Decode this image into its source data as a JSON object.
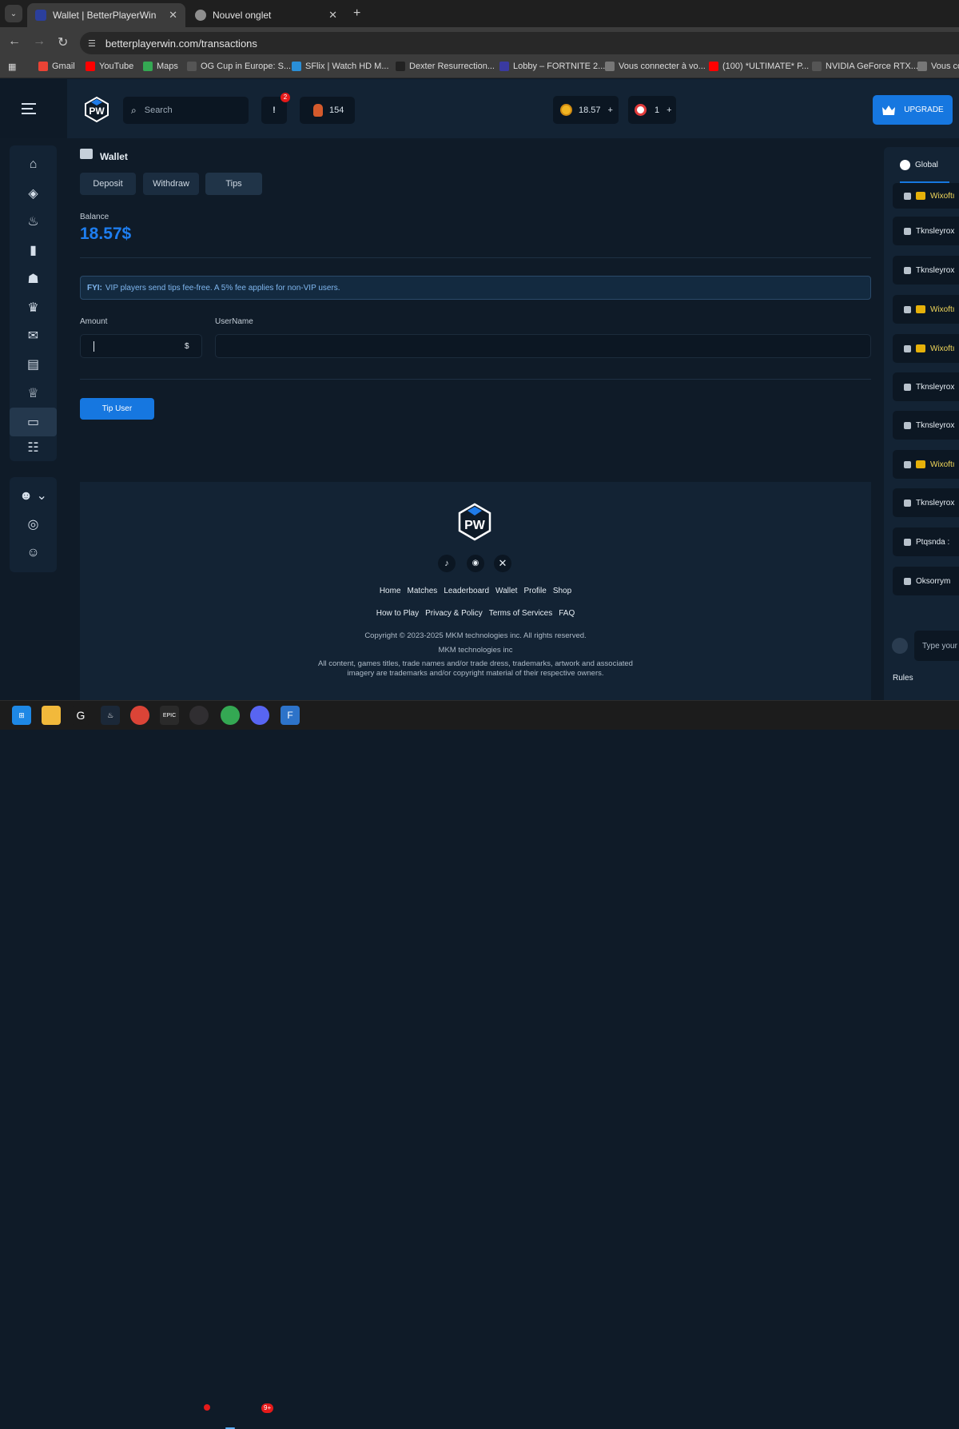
{
  "browser": {
    "tabs": [
      {
        "title": "Wallet | BetterPlayerWin",
        "active": true
      },
      {
        "title": "Nouvel onglet",
        "active": false
      }
    ],
    "url": "betterplayerwin.com/transactions",
    "bookmarks": [
      {
        "label": "Gmail",
        "icon": "gmail-icon",
        "color": "#ea4335"
      },
      {
        "label": "YouTube",
        "icon": "youtube-icon",
        "color": "#ff0000"
      },
      {
        "label": "Maps",
        "icon": "maps-icon",
        "color": "#34a853"
      },
      {
        "label": "OG Cup in Europe: S...",
        "icon": "site-icon",
        "color": "#555555"
      },
      {
        "label": "SFlix | Watch HD M...",
        "icon": "sflix-icon",
        "color": "#2a8fd8"
      },
      {
        "label": "Dexter Resurrection...",
        "icon": "site-icon",
        "color": "#222222"
      },
      {
        "label": "Lobby – FORTNITE 2...",
        "icon": "fortnite-icon",
        "color": "#3a3aa0"
      },
      {
        "label": "Vous connecter à vo...",
        "icon": "site-icon",
        "color": "#777777"
      },
      {
        "label": "(100) *ULTIMATE* P...",
        "icon": "youtube-icon",
        "color": "#ff0000"
      },
      {
        "label": "NVIDIA GeForce RTX...",
        "icon": "nvidia-icon",
        "color": "#555555"
      },
      {
        "label": "Vous co",
        "icon": "site-icon",
        "color": "#777777"
      }
    ]
  },
  "header": {
    "search_placeholder": "Search",
    "notif_badge": "2",
    "notif_label": "!",
    "gems": "154",
    "coins": "18.57",
    "coins_plus": "+",
    "tickets": "1",
    "tickets_plus": "+",
    "upgrade_label": "UPGRADE",
    "accent": "#1677e0"
  },
  "wallet": {
    "title": "Wallet",
    "tabs": [
      "Deposit",
      "Withdraw",
      "Tips"
    ],
    "active_tab": "Tips",
    "balance_label": "Balance",
    "balance_value": "18.57$",
    "fyi_prefix": "FYI:",
    "fyi_text": "VIP players send tips fee-free. A 5% fee applies for non-VIP users.",
    "amount_label": "Amount",
    "amount_currency": "$",
    "username_label": "UserName",
    "submit_label": "Tip User"
  },
  "footer": {
    "links_row1": [
      "Home",
      "Matches",
      "Leaderboard",
      "Wallet",
      "Profile",
      "Shop"
    ],
    "links_row2": [
      "How to Play",
      "Privacy & Policy",
      "Terms of Services",
      "FAQ"
    ],
    "copyright": "Copyright © 2023-2025 MKM technologies inc. All rights reserved.",
    "company": "MKM technologies inc",
    "disclaimer_1": "All content, games titles, trade names and/or trade dress, trademarks, artwork and associated",
    "disclaimer_2": "imagery are trademarks and/or copyright material of their respective owners."
  },
  "chat": {
    "tab_label": "Global",
    "messages": [
      {
        "name": "Wixoftı",
        "vip": true
      },
      {
        "name": "Tknsleyrox",
        "vip": false
      },
      {
        "name": "Tknsleyrox",
        "vip": false
      },
      {
        "name": "Wixoftı",
        "vip": true
      },
      {
        "name": "Wixoftı",
        "vip": true
      },
      {
        "name": "Tknsleyrox",
        "vip": false
      },
      {
        "name": "Tknsleyrox",
        "vip": false
      },
      {
        "name": "Wixoftı",
        "vip": true
      },
      {
        "name": "Tknsleyrox",
        "vip": false
      },
      {
        "name": "Ptqsnda :",
        "vip": false
      },
      {
        "name": "Oksorrym",
        "vip": false
      }
    ],
    "input_placeholder": "Type your",
    "rules_label": "Rules"
  },
  "taskbar": {
    "discord_badge": "9+"
  }
}
